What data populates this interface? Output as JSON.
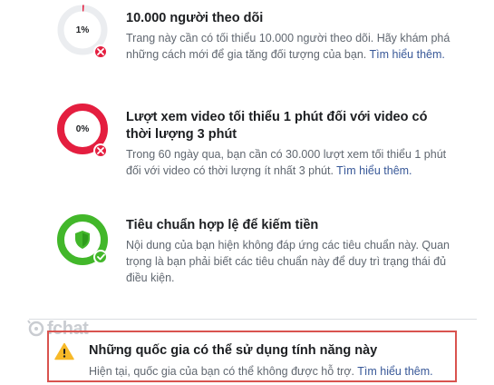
{
  "requirements": [
    {
      "percent_label": "1%",
      "progress": 0.01,
      "status": "failed",
      "title": "10.000 người theo dõi",
      "description": "Trang này cần có tối thiểu 10.000 người theo dõi. Hãy khám phá những cách mới để gia tăng đối tượng của bạn.",
      "link": "Tìm hiểu thêm."
    },
    {
      "percent_label": "0%",
      "progress": 0,
      "status": "failed",
      "title": "Lượt xem video tối thiểu 1 phút đối với video có thời lượng 3 phút",
      "description": "Trong 60 ngày qua, bạn cần có 30.000 lượt xem tối thiểu 1 phút đối với video có thời lượng ít nhất 3 phút.",
      "link": "Tìm hiểu thêm."
    },
    {
      "status": "passed",
      "title": "Tiêu chuẩn hợp lệ để kiếm tiền",
      "description": "Nội dung của bạn hiện không đáp ứng các tiêu chuẩn này. Quan trọng là bạn phải biết các tiêu chuẩn này để duy trì trạng thái đủ điều kiện."
    }
  ],
  "watermark": {
    "text": "fchat"
  },
  "notice": {
    "title": "Những quốc gia có thể sử dụng tính năng này",
    "description": "Hiện tại, quốc gia của bạn có thể không được hỗ trợ.",
    "link": "Tìm hiểu thêm."
  },
  "colors": {
    "failed_ring": "#e41e3f",
    "empty_ring": "#ebedf0",
    "passed_ring": "#42b72a",
    "link": "#385898",
    "warning": "#f7b928",
    "highlight_border": "#d9534f"
  },
  "icons": {
    "failed_badge": "close-icon",
    "passed_badge": "check-icon",
    "passed_center": "shield-check-icon",
    "notice": "warning-icon"
  }
}
